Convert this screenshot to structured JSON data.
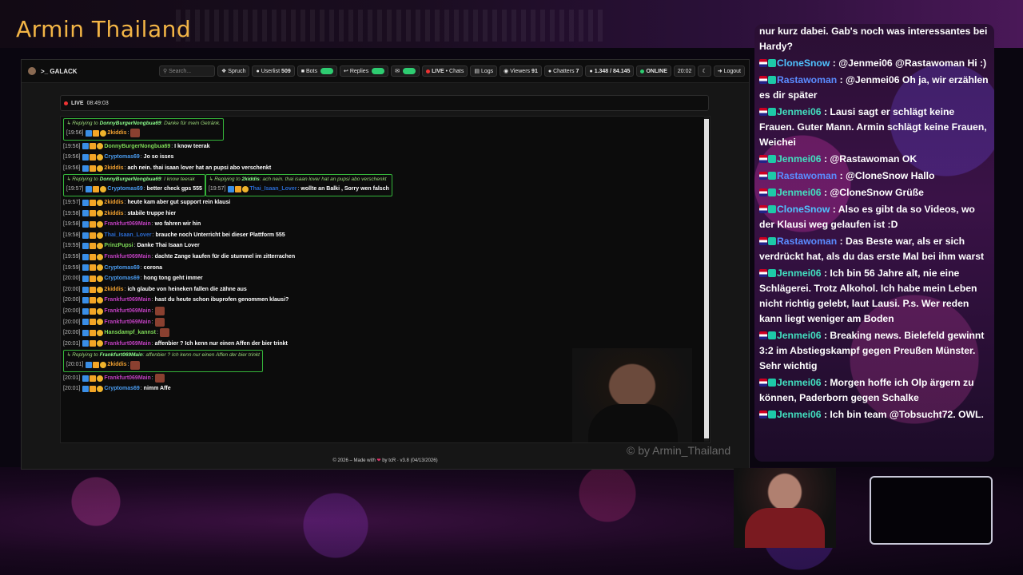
{
  "stream": {
    "title": "Armin Thailand",
    "watermark": "© by Armin_Thailand"
  },
  "navbar": {
    "brand": "GALACK",
    "search_placeholder": "Search...",
    "spruch": "Spruch",
    "userlist": "Userlist",
    "userlist_count": "509",
    "bots": "Bots",
    "replies": "Replies",
    "live": "LIVE",
    "live_sub": "• Chats",
    "logs": "Logs",
    "viewers": "Viewers",
    "viewers_count": "91",
    "chatters": "Chatters",
    "chatters_count": "7",
    "messages": "1.348 / 84.145",
    "online": "ONLINE",
    "time": "20:02",
    "logout": "Logout"
  },
  "livebar": {
    "label": "LIVE",
    "time": "08:49:03"
  },
  "chat": [
    {
      "type": "reply",
      "reply_to": "DonnyBurgerNongbua69",
      "reply_text": "Danke für mein Getränk.",
      "ts": "[19:56]",
      "user": "2kiddis",
      "color": "#f0a030",
      "text": ""
    },
    {
      "ts": "[19:56]",
      "user": "DonnyBurgerNongbua69",
      "color": "#7ed957",
      "text": "I know teerak"
    },
    {
      "ts": "[19:56]",
      "user": "Cryptomas69",
      "color": "#4a9cf0",
      "text": "Jo so isses"
    },
    {
      "ts": "[19:56]",
      "user": "2kiddis",
      "color": "#f0a030",
      "text": "ach nein. thai isaan lover hat an pupsi abo verschenkt"
    },
    {
      "type": "reply",
      "reply_to": "DonnyBurgerNongbua69",
      "reply_text": "I know teerak",
      "ts": "[19:57]",
      "user": "Cryptomas69",
      "color": "#4a9cf0",
      "text": "better check gps 555"
    },
    {
      "type": "reply",
      "reply_to": "2kiddis",
      "reply_text": "ach nein. thai isaan lover hat an pupsi abo verschenkt",
      "ts": "[19:57]",
      "user": "Thai_Isaan_Lover",
      "color": "#2a6ad0",
      "text": "wollte an Balki , Sorry wen falsch"
    },
    {
      "ts": "[19:57]",
      "user": "2kiddis",
      "color": "#f0a030",
      "text": "heute kam aber gut support rein klausi"
    },
    {
      "ts": "[19:58]",
      "user": "2kiddis",
      "color": "#f0a030",
      "text": "stabile truppe hier"
    },
    {
      "ts": "[19:58]",
      "user": "Frankfurt069Main",
      "color": "#c040c0",
      "text": "wo fahren wir hin"
    },
    {
      "ts": "[19:58]",
      "user": "Thai_Isaan_Lover",
      "color": "#2a6ad0",
      "text": "brauche noch Unterricht bei dieser Plattform 555"
    },
    {
      "ts": "[19:59]",
      "user": "PrinzPupsi",
      "color": "#7ed957",
      "text": "Danke Thai Isaan Lover"
    },
    {
      "ts": "[19:59]",
      "user": "Frankfurt069Main",
      "color": "#c040c0",
      "text": "dachte Zange kaufen für die stummel im zitterrachen"
    },
    {
      "ts": "[19:59]",
      "user": "Cryptomas69",
      "color": "#4a9cf0",
      "text": "corona"
    },
    {
      "ts": "[20:00]",
      "user": "Cryptomas69",
      "color": "#4a9cf0",
      "text": "hong tong geht immer"
    },
    {
      "ts": "[20:00]",
      "user": "2kiddis",
      "color": "#f0a030",
      "text": "ich glaube von heineken fallen die zähne aus"
    },
    {
      "ts": "[20:00]",
      "user": "Frankfurt069Main",
      "color": "#c040c0",
      "text": "hast du heute schon ibuprofen genommen klausi?"
    },
    {
      "ts": "[20:00]",
      "user": "Frankfurt069Main",
      "color": "#c040c0",
      "text": ""
    },
    {
      "ts": "[20:00]",
      "user": "Frankfurt069Main",
      "color": "#c040c0",
      "text": ""
    },
    {
      "ts": "[20:00]",
      "user": "Hansdampf_kannst",
      "color": "#7ed957",
      "text": ""
    },
    {
      "ts": "[20:01]",
      "user": "Frankfurt069Main",
      "color": "#c040c0",
      "text": "affenbier ? Ich kenn nur einen Affen der bier trinkt"
    },
    {
      "type": "reply",
      "reply_to": "Frankfurt069Main",
      "reply_text": "affenbier ? Ich kenn nur einen Affen der bier trinkt",
      "ts": "[20:01]",
      "user": "2kiddis",
      "color": "#f0a030",
      "text": ""
    },
    {
      "ts": "[20:01]",
      "user": "Frankfurt069Main",
      "color": "#c040c0",
      "text": ""
    },
    {
      "ts": "[20:01]",
      "user": "Cryptomas69",
      "color": "#4a9cf0",
      "text": "nimm Affe"
    }
  ],
  "reply_prefix": "Replying to",
  "footer": {
    "left": "© 2026 – Made with",
    "right": "by tcR · v3.8 (04/13/2026)"
  },
  "side_chat": [
    {
      "user": "",
      "color": "#fff",
      "text": "nur kurz dabei. Gab's noch was interessantes bei Hardy?"
    },
    {
      "user": "CloneSnow",
      "color": "#4fc3ff",
      "text": "@Jenmei06 @Rastawoman Hi :)"
    },
    {
      "user": "Rastawoman",
      "color": "#5a8cff",
      "text": "@Jenmei06 Oh ja, wir erzählen es dir später"
    },
    {
      "user": "Jenmei06",
      "color": "#42e0c0",
      "text": "Lausi sagt er schlägt keine Frauen. Guter Mann. Armin schlägt keine Frauen, Weichei"
    },
    {
      "user": "Jenmei06",
      "color": "#42e0c0",
      "text": "@Rastawoman OK"
    },
    {
      "user": "Rastawoman",
      "color": "#5a8cff",
      "text": "@CloneSnow Hallo"
    },
    {
      "user": "Jenmei06",
      "color": "#42e0c0",
      "text": "@CloneSnow Grüße"
    },
    {
      "user": "CloneSnow",
      "color": "#4fc3ff",
      "text": "Also es gibt da so Videos, wo der Klausi weg gelaufen ist :D"
    },
    {
      "user": "Rastawoman",
      "color": "#5a8cff",
      "text": "Das Beste war, als er sich verdrückt hat, als du das erste Mal bei ihm warst"
    },
    {
      "user": "Jenmei06",
      "color": "#42e0c0",
      "text": "Ich bin 56 Jahre alt, nie eine Schlägerei. Trotz Alkohol. Ich habe mein Leben nicht richtig gelebt, laut Lausi. P.s. Wer reden kann liegt weniger am Boden"
    },
    {
      "user": "Jenmei06",
      "color": "#42e0c0",
      "text": "Breaking news. Bielefeld gewinnt 3:2 im Abstiegskampf gegen Preußen Münster. Sehr wichtig"
    },
    {
      "user": "Jenmei06",
      "color": "#42e0c0",
      "text": "Morgen hoffe ich Olp ärgern zu können, Paderborn gegen Schalke"
    },
    {
      "user": "Jenmei06",
      "color": "#42e0c0",
      "text": "Ich bin team @Tobsucht72. OWL."
    }
  ]
}
